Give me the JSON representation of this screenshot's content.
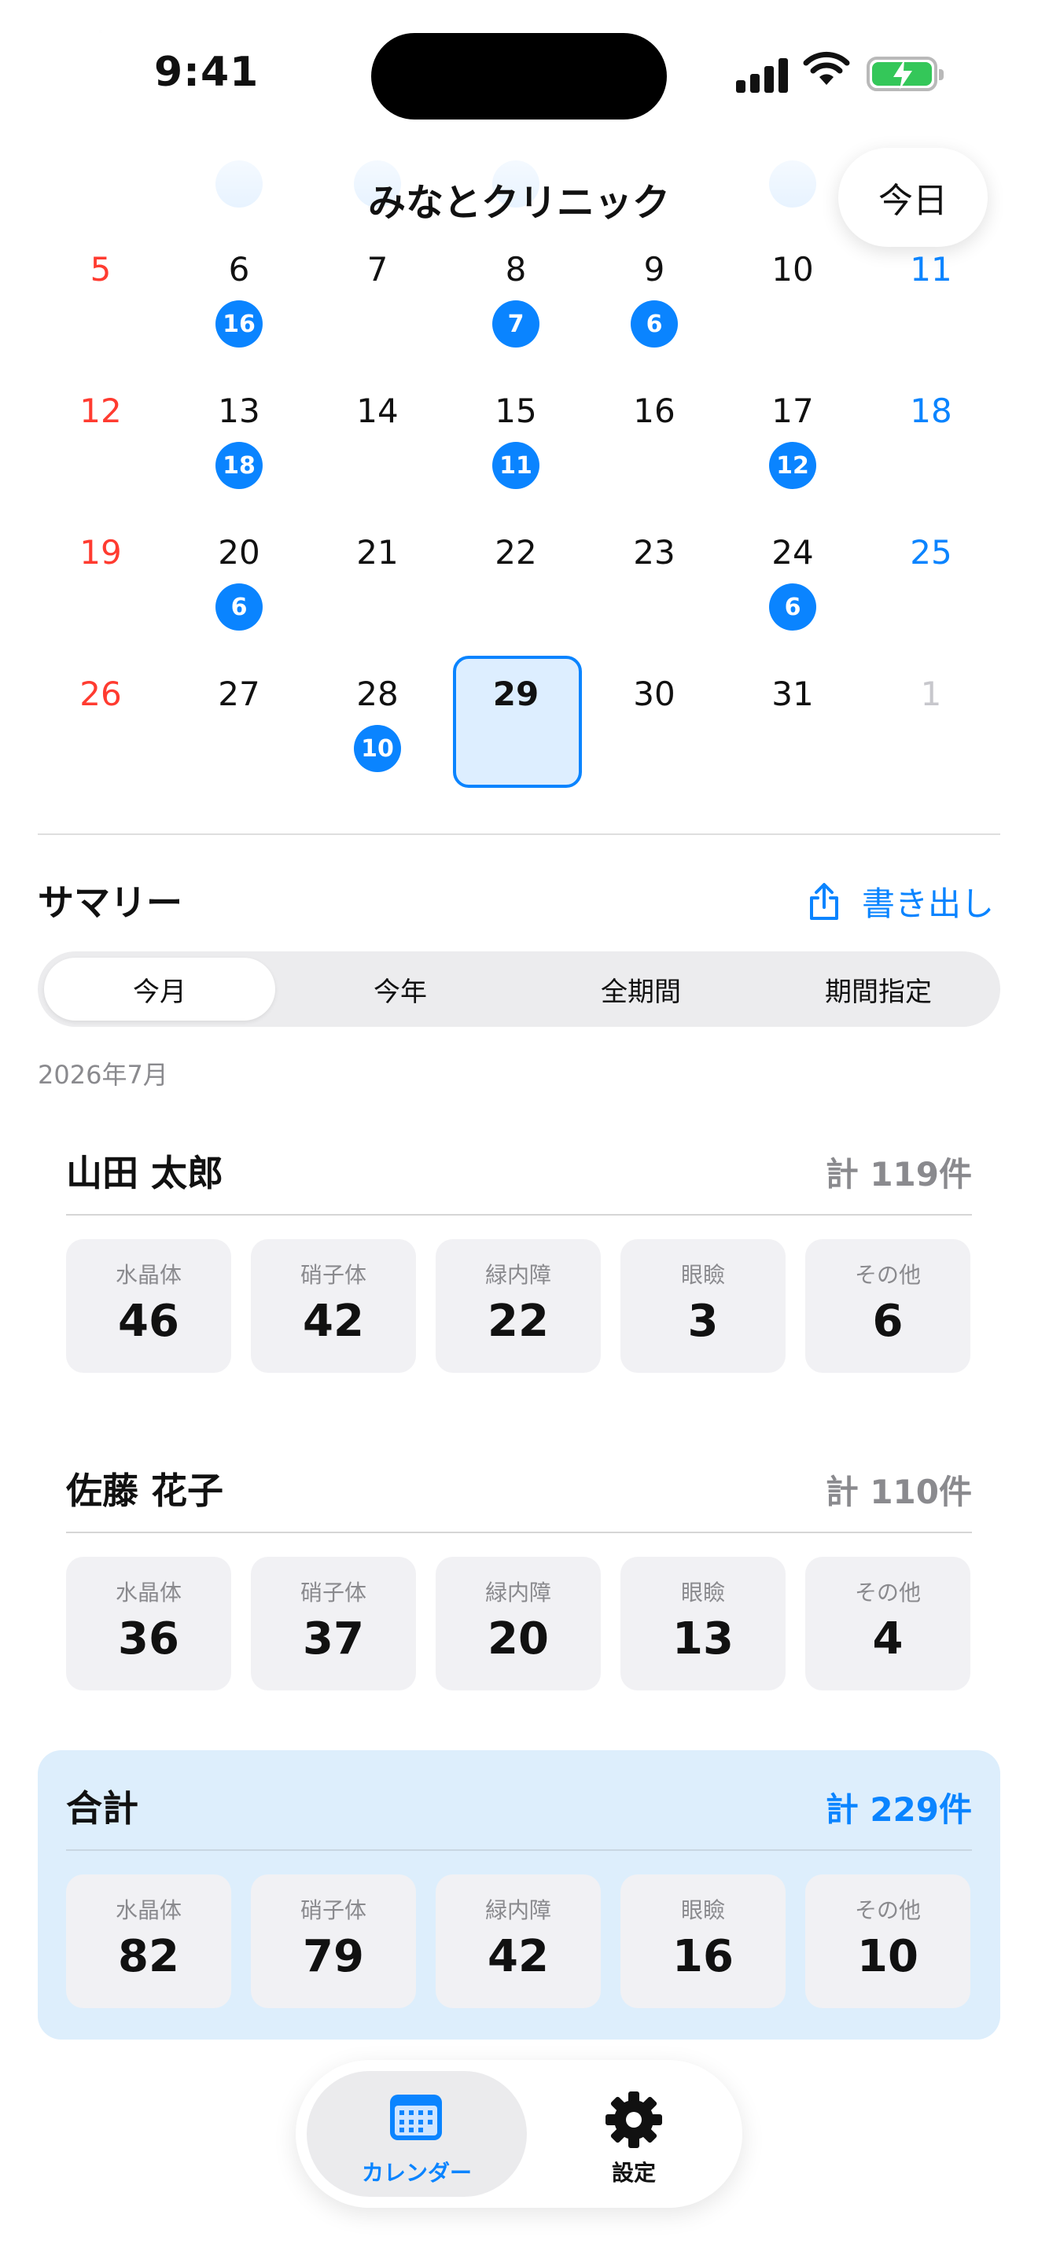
{
  "status_bar": {
    "time": "9:41"
  },
  "header": {
    "title": "みなとクリニック",
    "today_button": "今日"
  },
  "calendar": {
    "colors": {
      "sunday": "#ff3b30",
      "saturday": "#0a84ff",
      "weekday": "#111111",
      "outside": "#c7c7cc",
      "badge": "#0a84ff"
    },
    "weeks": [
      [
        {
          "d": "5",
          "b": ""
        },
        {
          "d": "6",
          "b": "16"
        },
        {
          "d": "7",
          "b": ""
        },
        {
          "d": "8",
          "b": "7"
        },
        {
          "d": "9",
          "b": "6"
        },
        {
          "d": "10",
          "b": ""
        },
        {
          "d": "11",
          "b": ""
        }
      ],
      [
        {
          "d": "12",
          "b": ""
        },
        {
          "d": "13",
          "b": "18"
        },
        {
          "d": "14",
          "b": ""
        },
        {
          "d": "15",
          "b": "11"
        },
        {
          "d": "16",
          "b": ""
        },
        {
          "d": "17",
          "b": "12"
        },
        {
          "d": "18",
          "b": ""
        }
      ],
      [
        {
          "d": "19",
          "b": ""
        },
        {
          "d": "20",
          "b": "6"
        },
        {
          "d": "21",
          "b": ""
        },
        {
          "d": "22",
          "b": ""
        },
        {
          "d": "23",
          "b": ""
        },
        {
          "d": "24",
          "b": "6"
        },
        {
          "d": "25",
          "b": ""
        }
      ],
      [
        {
          "d": "26",
          "b": ""
        },
        {
          "d": "27",
          "b": ""
        },
        {
          "d": "28",
          "b": "10"
        },
        {
          "d": "29",
          "b": "",
          "selected": true
        },
        {
          "d": "30",
          "b": ""
        },
        {
          "d": "31",
          "b": ""
        },
        {
          "d": "1",
          "b": "",
          "outside": true
        }
      ]
    ]
  },
  "summary": {
    "title": "サマリー",
    "export_label": "書き出し",
    "segments": [
      "今月",
      "今年",
      "全期間",
      "期間指定"
    ],
    "active_segment": 0,
    "period": "2026年7月",
    "categories": [
      "水晶体",
      "硝子体",
      "緑内障",
      "眼瞼",
      "その他"
    ],
    "people": [
      {
        "name": "山田 太郎",
        "total": "計 119件",
        "values": [
          "46",
          "42",
          "22",
          "3",
          "6"
        ]
      },
      {
        "name": "佐藤 花子",
        "total": "計 110件",
        "values": [
          "36",
          "37",
          "20",
          "13",
          "4"
        ]
      }
    ],
    "grand_total": {
      "name": "合計",
      "total": "計 229件",
      "values": [
        "82",
        "79",
        "42",
        "16",
        "10"
      ]
    }
  },
  "tab_bar": {
    "calendar_label": "カレンダー",
    "settings_label": "設定",
    "active": "calendar"
  }
}
